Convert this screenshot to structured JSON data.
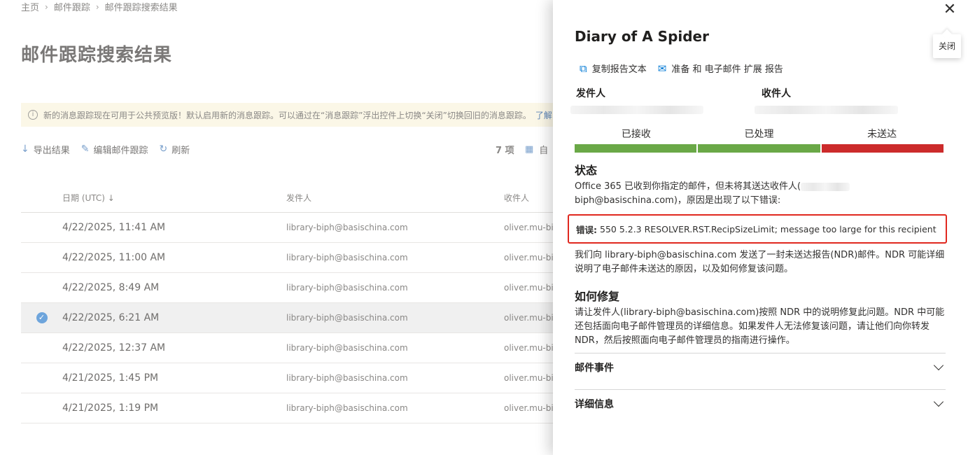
{
  "breadcrumb": [
    "主页",
    "邮件跟踪",
    "邮件跟踪搜索结果"
  ],
  "page_title": "邮件跟踪搜索结果",
  "banner": {
    "text": "新的消息跟踪现在可用于公共预览版！默认启用新的消息跟踪。可以通过在“消息跟踪”浮出控件上切换“关闭”切换回旧的消息跟踪。",
    "link": "了解"
  },
  "toolbar": {
    "export": "导出结果",
    "edit": "编辑邮件跟踪",
    "refresh": "刷新",
    "count": "7 项",
    "more": "自"
  },
  "grid": {
    "headers": {
      "date": "日期 (UTC) ↓",
      "sender": "发件人",
      "recipient": "收件人"
    },
    "rows": [
      {
        "date": "4/22/2025, 11:41 AM",
        "sender": "library-biph@basischina.com",
        "recipient": "oliver.mu-bip"
      },
      {
        "date": "4/22/2025, 11:00 AM",
        "sender": "library-biph@basischina.com",
        "recipient": "oliver.mu-bip"
      },
      {
        "date": "4/22/2025, 8:49 AM",
        "sender": "library-biph@basischina.com",
        "recipient": "oliver.mu-bip"
      },
      {
        "date": "4/22/2025, 6:21 AM",
        "sender": "library-biph@basischina.com",
        "recipient": "oliver.mu-bip",
        "selected": true
      },
      {
        "date": "4/22/2025, 12:37 AM",
        "sender": "library-biph@basischina.com",
        "recipient": "oliver.mu-bip"
      },
      {
        "date": "4/21/2025, 1:45 PM",
        "sender": "library-biph@basischina.com",
        "recipient": "oliver.mu-bip"
      },
      {
        "date": "4/21/2025, 1:19 PM",
        "sender": "library-biph@basischina.com",
        "recipient": "oliver.mu-bip"
      }
    ]
  },
  "panel": {
    "close_tooltip": "关闭",
    "title": "Diary of A Spider",
    "actions": {
      "copy": "复制报告文本",
      "prepare": "准备 和 电子邮件 扩展 报告"
    },
    "sender_label": "发件人",
    "recipient_label": "收件人",
    "stages": [
      {
        "label": "已接收",
        "color": "#6aa847"
      },
      {
        "label": "已处理",
        "color": "#6aa847"
      },
      {
        "label": "未送达",
        "color": "#cc2b2b"
      }
    ],
    "status_title": "状态",
    "status_line1": "Office 365 已收到你指定的邮件，但未将其送达收件人(",
    "status_line2": "biph@basischina.com)，原因是出现了以下错误:",
    "error_label": "错误:",
    "error_text": "550 5.2.3 RESOLVER.RST.RecipSizeLimit; message too large for this recipient",
    "ndr_text": "我们向 library-biph@basischina.com 发送了一封未送达报告(NDR)邮件。NDR 可能详细说明了电子邮件未送达的原因，以及如何修复该问题。",
    "fix_title": "如何修复",
    "fix_text": "请让发件人(library-biph@basischina.com)按照 NDR 中的说明修复此问题。NDR 中可能还包括面向电子邮件管理员的详细信息。如果发件人无法修复该问题，请让他们向你转发 NDR，然后按照面向电子邮件管理员的指南进行操作。",
    "events_title": "邮件事件",
    "details_title": "详细信息"
  }
}
